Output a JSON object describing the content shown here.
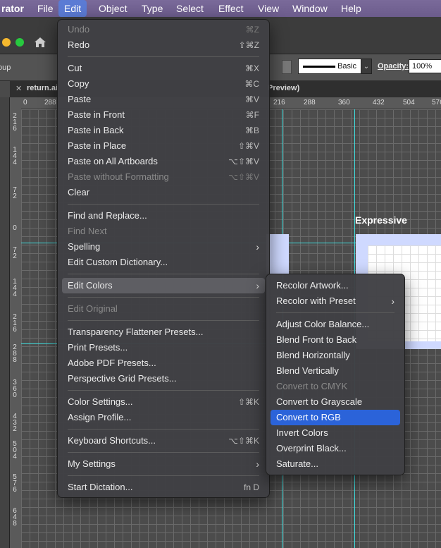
{
  "menubar": {
    "app_name": "rator",
    "items": [
      "File",
      "Edit",
      "Object",
      "Type",
      "Select",
      "Effect",
      "View",
      "Window",
      "Help"
    ]
  },
  "control_bar": {
    "group_label": "oup",
    "stroke_profile": "Basic",
    "opacity_label": "Opacity:",
    "opacity_value": "100%"
  },
  "document": {
    "tab_label": "return.ai",
    "tab_label_right": "Preview)"
  },
  "rulers": {
    "horizontal": [
      "0",
      "288",
      "216",
      "288",
      "360",
      "432",
      "504",
      "576"
    ],
    "vertical": [
      "2 1 6",
      "1 4 4",
      "7 2",
      "0",
      "7 2",
      "1 4 4",
      "2 1 6",
      "2 8 8",
      "3 6 0",
      "4 3 2",
      "5 0 4",
      "5 7 6",
      "6 4 8"
    ]
  },
  "artboard": {
    "name": "Expressive"
  },
  "edit_menu": {
    "items": [
      {
        "label": "Undo",
        "shortcut": "⌘Z",
        "disabled": true
      },
      {
        "label": "Redo",
        "shortcut": "⇧⌘Z"
      },
      {
        "label": "Cut",
        "shortcut": "⌘X"
      },
      {
        "label": "Copy",
        "shortcut": "⌘C"
      },
      {
        "label": "Paste",
        "shortcut": "⌘V"
      },
      {
        "label": "Paste in Front",
        "shortcut": "⌘F"
      },
      {
        "label": "Paste in Back",
        "shortcut": "⌘B"
      },
      {
        "label": "Paste in Place",
        "shortcut": "⇧⌘V"
      },
      {
        "label": "Paste on All Artboards",
        "shortcut": "⌥⇧⌘V"
      },
      {
        "label": "Paste without Formatting",
        "shortcut": "⌥⇧⌘V",
        "disabled": true
      },
      {
        "label": "Clear",
        "shortcut": ""
      },
      {
        "label": "Find and Replace...",
        "shortcut": ""
      },
      {
        "label": "Find Next",
        "shortcut": "",
        "disabled": true
      },
      {
        "label": "Spelling",
        "shortcut": "",
        "submenu": true
      },
      {
        "label": "Edit Custom Dictionary...",
        "shortcut": ""
      },
      {
        "label": "Edit Colors",
        "shortcut": "",
        "submenu": true,
        "highlight": true
      },
      {
        "label": "Edit Original",
        "shortcut": "",
        "disabled": true
      },
      {
        "label": "Transparency Flattener Presets...",
        "shortcut": ""
      },
      {
        "label": "Print Presets...",
        "shortcut": ""
      },
      {
        "label": "Adobe PDF Presets...",
        "shortcut": ""
      },
      {
        "label": "Perspective Grid Presets...",
        "shortcut": ""
      },
      {
        "label": "Color Settings...",
        "shortcut": "⇧⌘K"
      },
      {
        "label": "Assign Profile...",
        "shortcut": ""
      },
      {
        "label": "Keyboard Shortcuts...",
        "shortcut": "⌥⇧⌘K"
      },
      {
        "label": "My Settings",
        "shortcut": "",
        "submenu": true
      },
      {
        "label": "Start Dictation...",
        "shortcut": "fn D"
      }
    ]
  },
  "edit_colors_submenu": {
    "items": [
      {
        "label": "Recolor Artwork..."
      },
      {
        "label": "Recolor with Preset",
        "submenu": true
      },
      {
        "label": "Adjust Color Balance..."
      },
      {
        "label": "Blend Front to Back"
      },
      {
        "label": "Blend Horizontally"
      },
      {
        "label": "Blend Vertically"
      },
      {
        "label": "Convert to CMYK",
        "disabled": true
      },
      {
        "label": "Convert to Grayscale"
      },
      {
        "label": "Convert to RGB",
        "selected": true
      },
      {
        "label": "Invert Colors"
      },
      {
        "label": "Overprint Black..."
      },
      {
        "label": "Saturate..."
      }
    ]
  },
  "icons": {
    "home": "home-icon",
    "submenu_arrow": "chevron-right-icon",
    "dropdown": "chevron-down-icon",
    "close_tab": "close-icon"
  },
  "colors": {
    "selection": "#2b63d9",
    "guides": "#40e0e0",
    "menubar": "#6c5c8c"
  }
}
